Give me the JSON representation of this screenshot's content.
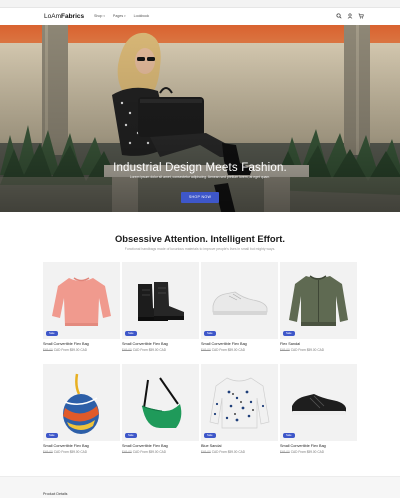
{
  "announcement": {
    "text": "Free shipping available on all orders!"
  },
  "header": {
    "logo_prefix": "LoAm",
    "logo_bold": "Fabrics",
    "nav": [
      {
        "label": "Shop",
        "has_menu": true
      },
      {
        "label": "Pages",
        "has_menu": true
      },
      {
        "label": "Lookbook",
        "has_menu": false
      }
    ],
    "icons": [
      "search-icon",
      "user-icon",
      "cart-icon"
    ]
  },
  "hero": {
    "heading": "Industrial Design Meets Fashion.",
    "subtext": "Lorem ipsum dolor sit amet, consectetur adipiscing. Aenean sed pretium lorem, at eget quam.",
    "button_label": "SHOP NOW",
    "button_color": "#3e57c9"
  },
  "section": {
    "title": "Obsessive Attention. Intelligent Effort.",
    "subtitle": "Functional handbags made of luxurious materials to improve people's lives in small but mighty ways."
  },
  "products": [
    {
      "name": "Small Convertible Flex Bag",
      "old_price": "$49.00",
      "price": "CAD From $59.00 CAD",
      "badge": "Sale",
      "icon": "sweater-icon"
    },
    {
      "name": "Small Convertible Flex Bag",
      "old_price": "$49.00",
      "price": "CAD From $59.00 CAD",
      "badge": "Sale",
      "icon": "boots-icon"
    },
    {
      "name": "Small Convertible Flex Bag",
      "old_price": "$49.00",
      "price": "CAD From $59.00 CAD",
      "badge": "Sale",
      "icon": "sneaker-icon"
    },
    {
      "name": "Flex Sandal",
      "old_price": "$49.00",
      "price": "CAD From $59.00 CAD",
      "badge": "Sale",
      "icon": "bomber-jacket-icon"
    },
    {
      "name": "Small Convertible Flex Bag",
      "old_price": "$49.00",
      "price": "CAD From $59.00 CAD",
      "badge": "Sale",
      "icon": "bag-icon"
    },
    {
      "name": "Small Convertible Flex Bag",
      "old_price": "$49.00",
      "price": "CAD From $59.00 CAD",
      "badge": "Sale",
      "icon": "shoulder-bag-icon"
    },
    {
      "name": "Blue Sandal",
      "old_price": "$49.00",
      "price": "CAD From $59.00 CAD",
      "badge": "Sale",
      "icon": "sweatshirt-icon"
    },
    {
      "name": "Small Convertible Flex Bag",
      "old_price": "$49.00",
      "price": "CAD From $59.00 CAD",
      "badge": "Sale",
      "icon": "runner-shoe-icon"
    }
  ],
  "footer_peek": {
    "label": "Product Details"
  }
}
